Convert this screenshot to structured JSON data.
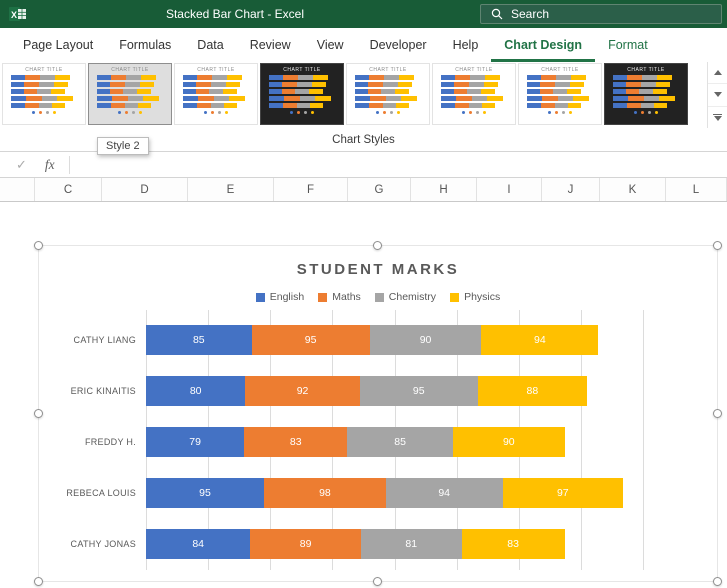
{
  "title_bar": {
    "app_title": "Stacked Bar Chart  -  Excel",
    "search_label": "Search"
  },
  "ribbon": {
    "tabs": [
      {
        "label": "Page Layout",
        "active": false,
        "contextual": false
      },
      {
        "label": "Formulas",
        "active": false,
        "contextual": false
      },
      {
        "label": "Data",
        "active": false,
        "contextual": false
      },
      {
        "label": "Review",
        "active": false,
        "contextual": false
      },
      {
        "label": "View",
        "active": false,
        "contextual": false
      },
      {
        "label": "Developer",
        "active": false,
        "contextual": false
      },
      {
        "label": "Help",
        "active": false,
        "contextual": false
      },
      {
        "label": "Chart Design",
        "active": true,
        "contextual": true
      },
      {
        "label": "Format",
        "active": false,
        "contextual": true
      }
    ],
    "group_label": "Chart Styles",
    "tooltip": "Style 2",
    "thumb_title": "Chart Title",
    "styles": [
      {
        "dark": false,
        "selected": false
      },
      {
        "dark": false,
        "selected": true
      },
      {
        "dark": false,
        "selected": false
      },
      {
        "dark": true,
        "selected": false
      },
      {
        "dark": false,
        "selected": false
      },
      {
        "dark": false,
        "selected": false
      },
      {
        "dark": false,
        "selected": false
      },
      {
        "dark": true,
        "selected": false
      }
    ]
  },
  "formula_bar": {
    "check": "✓",
    "fx": "fx",
    "value": ""
  },
  "grid": {
    "columns": [
      "C",
      "D",
      "E",
      "F",
      "G",
      "H",
      "I",
      "J",
      "K",
      "L"
    ]
  },
  "chart_data": {
    "type": "bar",
    "orientation": "horizontal",
    "stacked": true,
    "title": "STUDENT MARKS",
    "categories": [
      "CATHY LIANG",
      "ERIC KINAITIS",
      "FREDDY H.",
      "REBECA LOUIS",
      "CATHY JONAS"
    ],
    "series": [
      {
        "name": "English",
        "color": "#4472C4",
        "values": [
          85,
          80,
          79,
          95,
          84
        ]
      },
      {
        "name": "Maths",
        "color": "#ED7D31",
        "values": [
          95,
          92,
          83,
          98,
          89
        ]
      },
      {
        "name": "Chemistry",
        "color": "#A5A5A5",
        "values": [
          90,
          95,
          85,
          94,
          81
        ]
      },
      {
        "name": "Physics",
        "color": "#FFC000",
        "values": [
          94,
          88,
          90,
          97,
          83
        ]
      }
    ],
    "xlim": [
      0,
      400
    ],
    "grid": true,
    "legend_position": "top",
    "accent_color": "#217346"
  }
}
